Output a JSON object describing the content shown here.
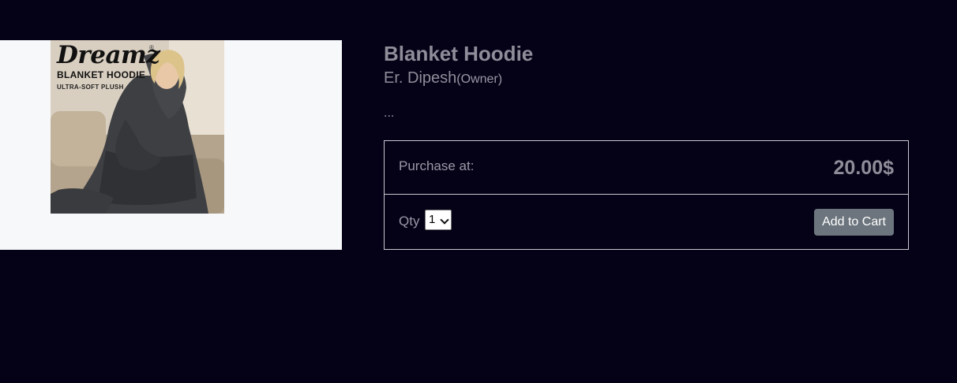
{
  "product": {
    "image_text": {
      "brand": "Dreamz",
      "brand_mark": "®",
      "line1": "BLANKET HOODIE",
      "line2": "ULTRA-SOFT PLUSH"
    },
    "title": "Blanket Hoodie",
    "owner_name": "Er. Dipesh",
    "owner_role": "(Owner)",
    "description": "..."
  },
  "purchase": {
    "label": "Purchase at:",
    "price": "20.00$",
    "qty_label": "Qty",
    "qty_value": "1",
    "add_to_cart": "Add to Cart"
  },
  "colors": {
    "page_background": "#050217",
    "image_panel_background": "#f6f8fa",
    "button_background": "#6c757d"
  }
}
